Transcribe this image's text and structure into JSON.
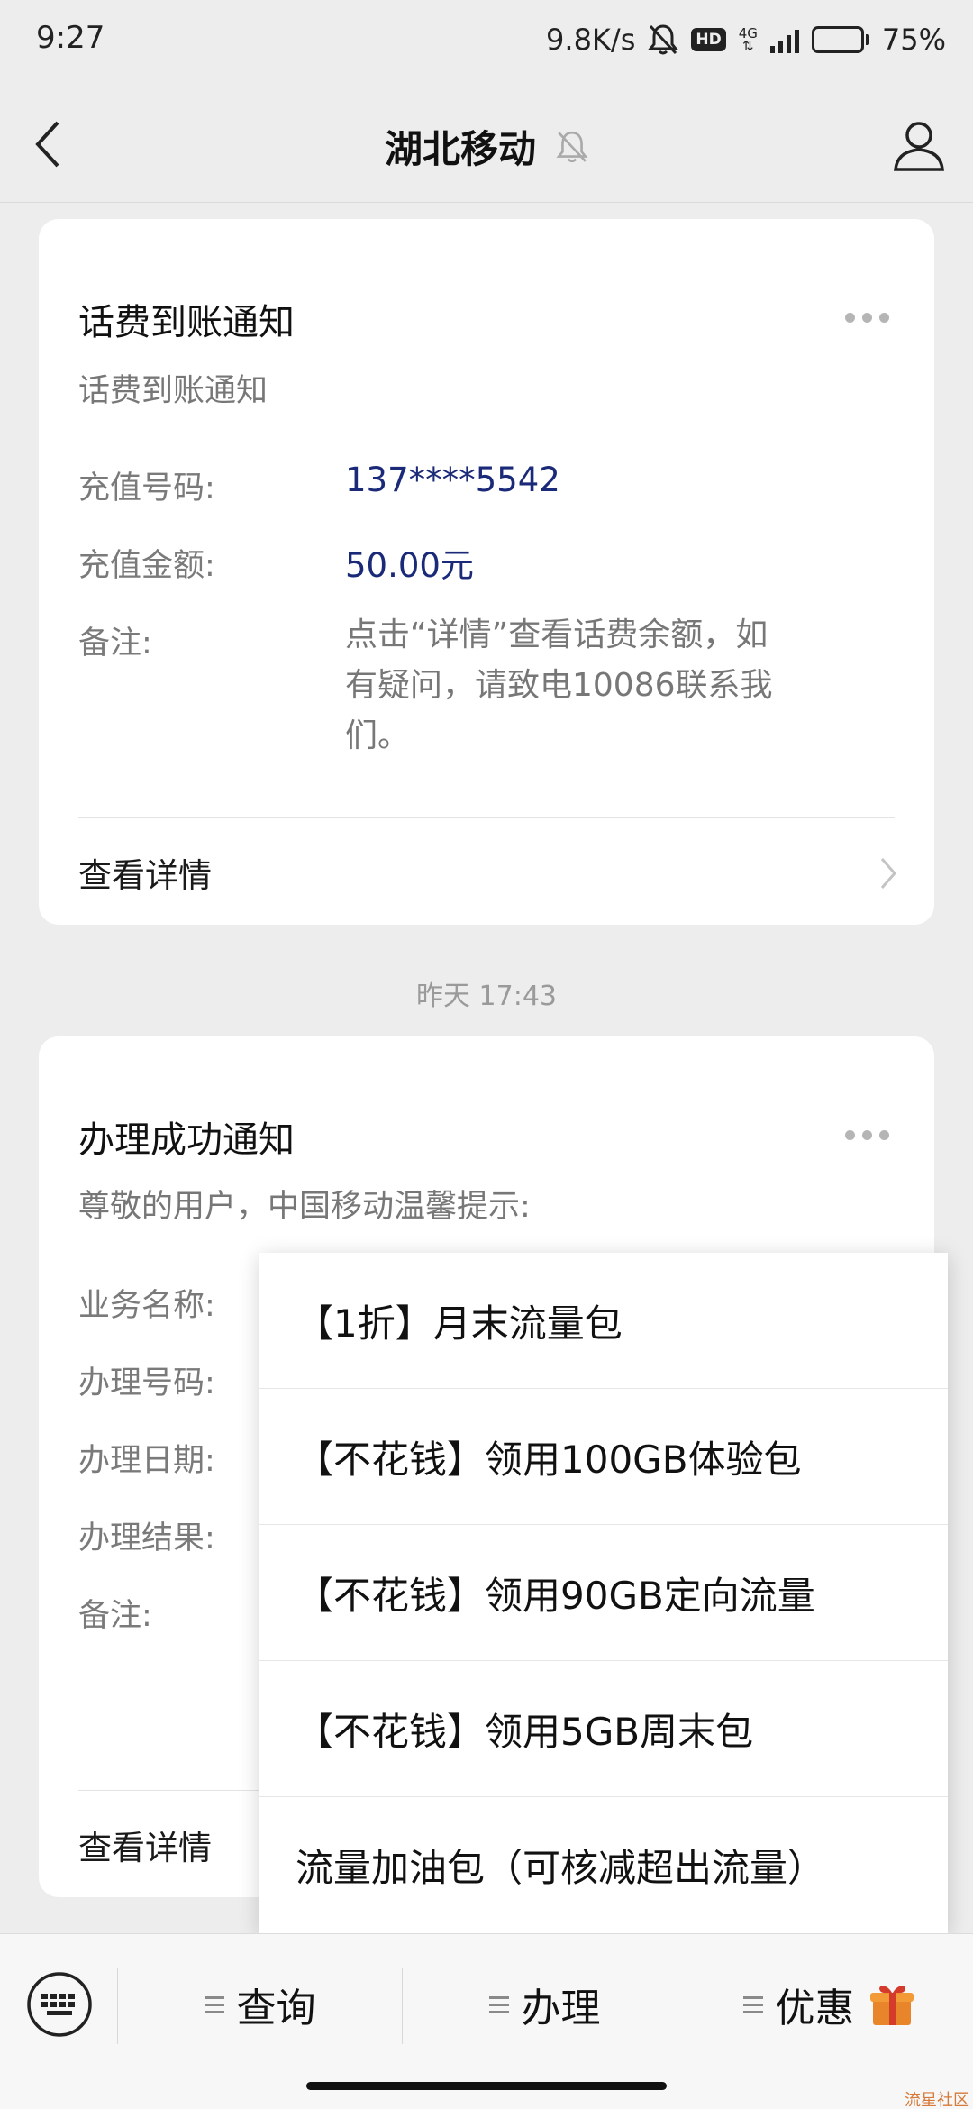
{
  "status_bar": {
    "time": "9:27",
    "net_speed": "9.8K/s",
    "hd_label": "HD",
    "network_type": "4G",
    "battery": "75%",
    "battery_level": 0.75
  },
  "nav": {
    "title": "湖北移动",
    "icons": [
      "back-icon",
      "mute-bell-icon",
      "user-icon"
    ]
  },
  "card1": {
    "title": "话费到账通知",
    "subtitle": "话费到账通知",
    "fields": [
      {
        "label": "充值号码:",
        "value": "137****5542"
      },
      {
        "label": "充值金额:",
        "value": "50.00元"
      }
    ],
    "note_label": "备注:",
    "note_lines": [
      "点击“详情”查看话费余额，如",
      "有疑问，请致电10086联系我",
      "们。"
    ],
    "link": "查看详情"
  },
  "timestamp": "昨天 17:43",
  "card2": {
    "title": "办理成功通知",
    "subtitle": "尊敬的用户，中国移动温馨提示:",
    "field_labels": [
      "业务名称:",
      "办理号码:",
      "办理日期:",
      "办理结果:",
      "备注:"
    ],
    "link": "查看详情"
  },
  "popup_menu": {
    "items": [
      "【1折】月末流量包",
      "【不花钱】领用100GB体验包",
      "【不花钱】领用90GB定向流量",
      "【不花钱】领用5GB周末包",
      "流量加油包（可核减超出流量）"
    ]
  },
  "bottom_bar": {
    "tabs": [
      "查询",
      "办理",
      "优惠"
    ],
    "icons": [
      "keyboard-icon",
      "menu-lines-icon",
      "gift-icon"
    ]
  },
  "watermark": "流星社区"
}
